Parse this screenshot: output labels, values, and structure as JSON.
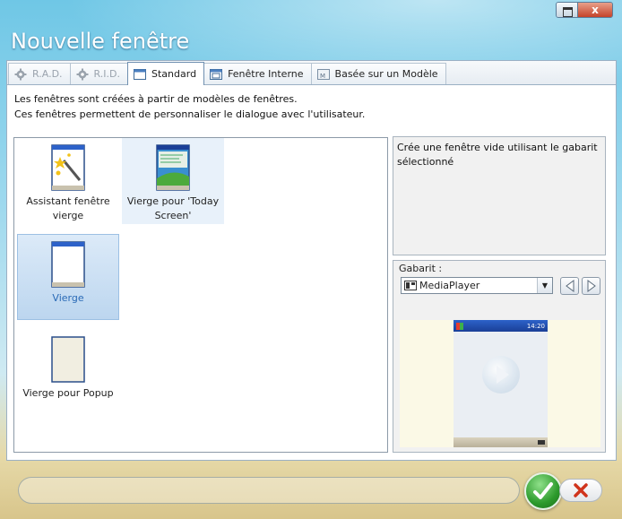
{
  "window": {
    "title": "Nouvelle fenêtre",
    "close_glyph": "x"
  },
  "tabs": [
    {
      "label": "R.A.D.",
      "state": "disabled",
      "icon": "rad-gear-icon"
    },
    {
      "label": "R.I.D.",
      "state": "disabled",
      "icon": "rid-gear-icon"
    },
    {
      "label": "Standard",
      "state": "active",
      "icon": "window-icon"
    },
    {
      "label": "Fenêtre Interne",
      "state": "normal",
      "icon": "internal-window-icon"
    },
    {
      "label": "Basée sur un Modèle",
      "state": "normal",
      "icon": "template-icon"
    }
  ],
  "description": {
    "line1": "Les fenêtres sont créées à partir de modèles de fenêtres.",
    "line2": "Ces fenêtres permettent de personnaliser le dialogue avec l'utilisateur."
  },
  "templates": [
    {
      "label": "Assistant fenêtre vierge",
      "state": "normal"
    },
    {
      "label": "Vierge pour 'Today Screen'",
      "state": "hover"
    },
    {
      "label": "Vierge",
      "state": "selected"
    },
    {
      "label": "Vierge pour Popup",
      "state": "normal"
    }
  ],
  "info_text": "Crée une fenêtre vide utilisant le gabarit sélectionné",
  "gabarit": {
    "label": "Gabarit :",
    "selected": "MediaPlayer",
    "device_time": "14:20"
  },
  "colors": {
    "accent": "#2a6ab6",
    "selection": "#bcd6ef",
    "ok": "#2c9a2c",
    "cancel": "#d0341c"
  }
}
